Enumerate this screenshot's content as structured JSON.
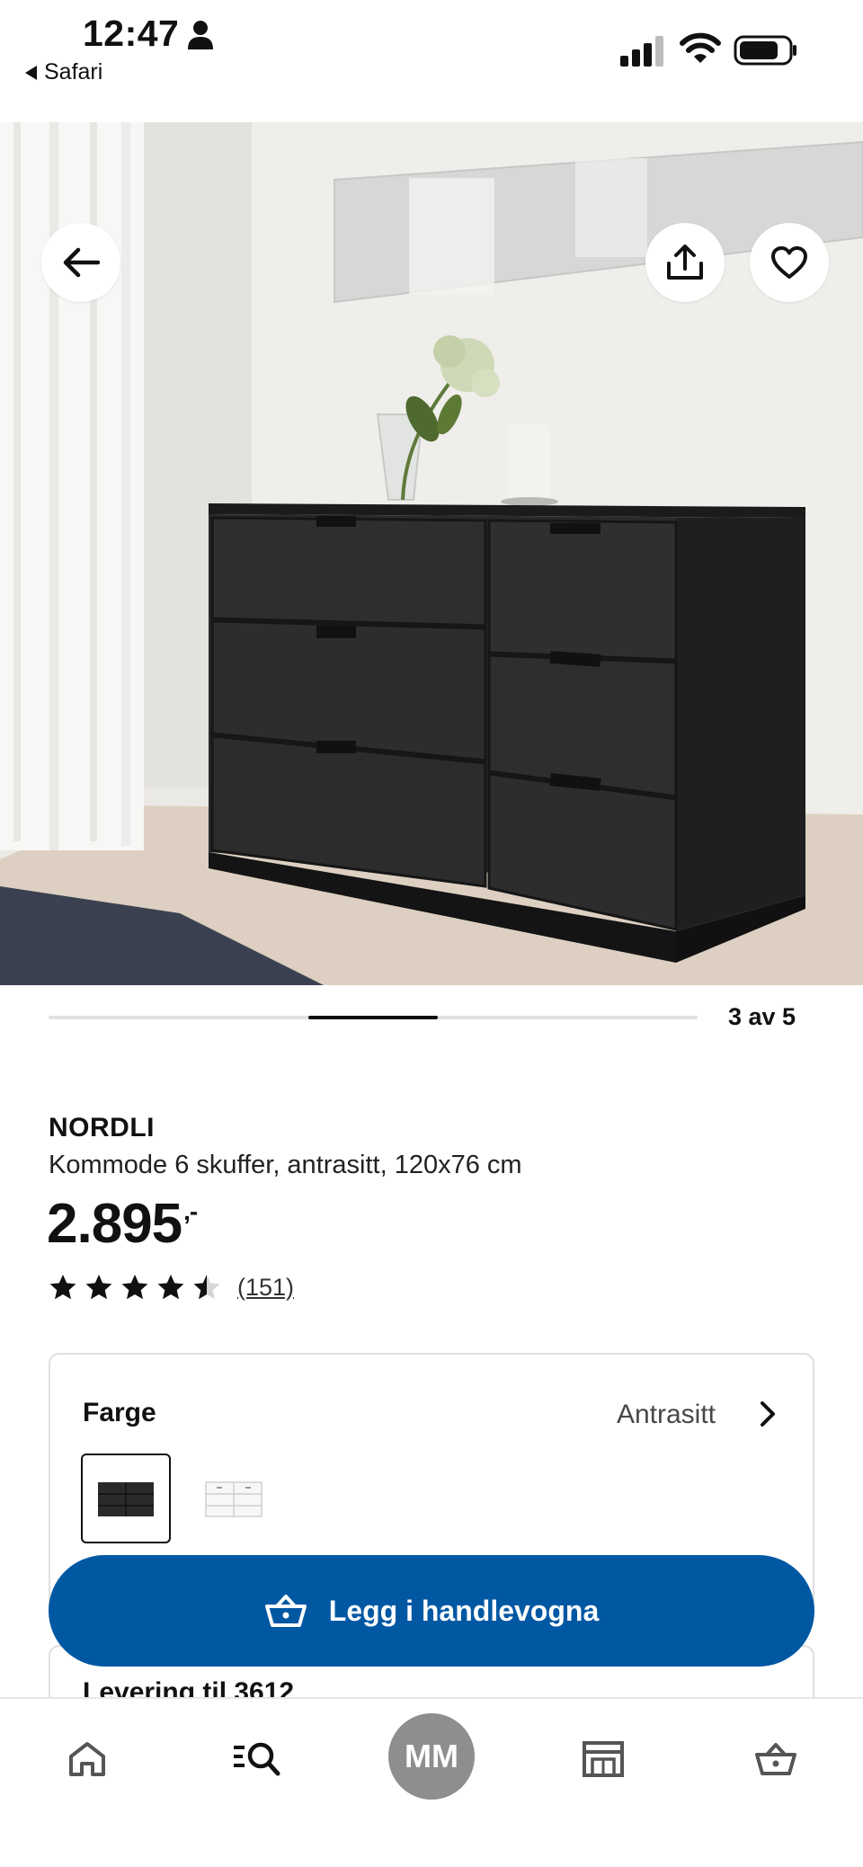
{
  "status_bar": {
    "time": "12:47",
    "back_app": "Safari"
  },
  "gallery": {
    "counter": "3 av 5",
    "current_index": 3,
    "total": 5
  },
  "product": {
    "name": "NORDLI",
    "description": "Kommode 6 skuffer, antrasitt, 120x76 cm",
    "price": "2.895",
    "price_suffix": ",-",
    "rating": 4.5,
    "review_count": "(151)"
  },
  "color": {
    "label": "Farge",
    "selected": "Antrasitt",
    "options": [
      "Antrasitt",
      "Hvit"
    ]
  },
  "cart": {
    "label": "Legg i handlevogna"
  },
  "delivery": {
    "title": "Levering til 3612"
  },
  "nav": {
    "profile_initials": "MM"
  },
  "colors": {
    "brand_blue": "#0058a3",
    "anthracite": "#262626"
  }
}
